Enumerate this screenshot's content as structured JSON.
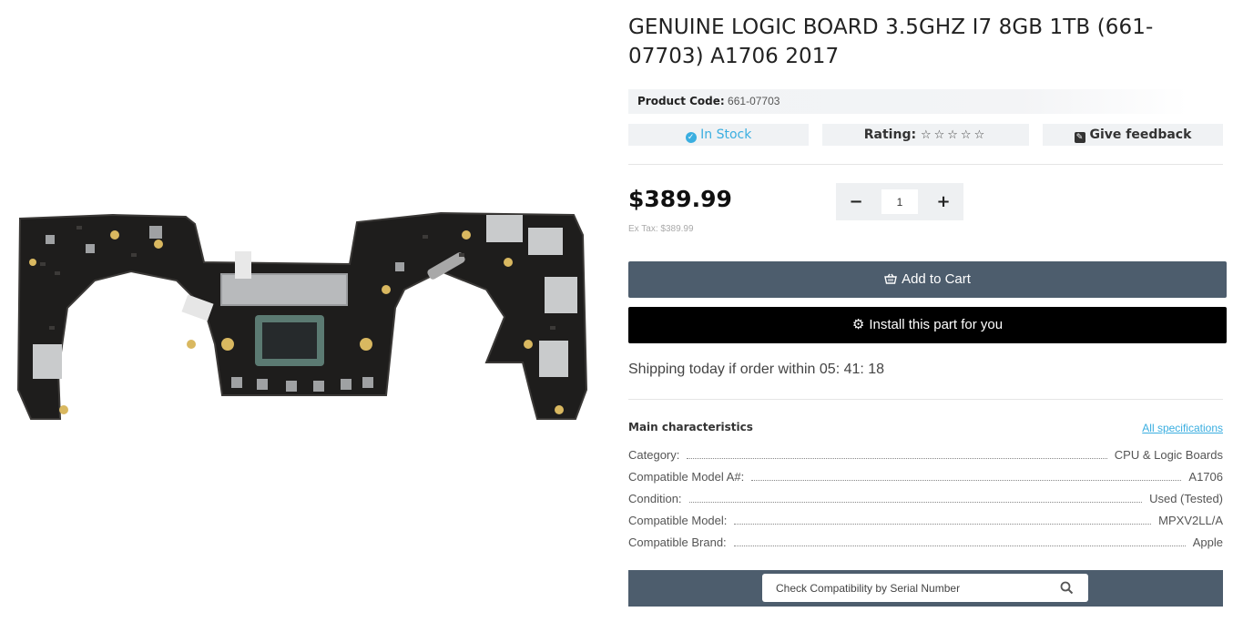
{
  "product": {
    "title": "GENUINE LOGIC BOARD 3.5GHZ I7 8GB 1TB (661-07703) A1706 2017",
    "code_label": "Product Code:",
    "code_value": "661-07703",
    "stock": "In Stock",
    "rating_label": "Rating:",
    "rating_stars": "☆☆☆☆☆",
    "rating_value": 0,
    "feedback_label": "Give feedback",
    "price": "$389.99",
    "ex_tax": "Ex Tax: $389.99",
    "quantity": "1",
    "qty_minus": "−",
    "qty_plus": "+"
  },
  "actions": {
    "add_to_cart": "Add to Cart",
    "install": "Install this part for you"
  },
  "shipping": {
    "text": "Shipping today if order within",
    "timer": "05: 41: 18"
  },
  "characteristics": {
    "title": "Main characteristics",
    "all_specs": "All specifications",
    "rows": [
      {
        "label": "Category:",
        "value": "CPU & Logic Boards"
      },
      {
        "label": "Compatible Model A#:",
        "value": "A1706"
      },
      {
        "label": "Condition:",
        "value": "Used (Tested)"
      },
      {
        "label": "Compatible Model:",
        "value": "MPXV2LL/A"
      },
      {
        "label": "Compatible Brand:",
        "value": "Apple"
      }
    ]
  },
  "serial_check": {
    "placeholder": "Check Compatibility by Serial Number"
  },
  "icons": {
    "stock": "check-circle-icon",
    "feedback": "edit-icon",
    "cart": "basket-icon",
    "install": "gear-icon",
    "search": "search-icon"
  },
  "colors": {
    "accent": "#3aaee0",
    "button_dark": "#4d5d6d",
    "button_black": "#000000"
  }
}
